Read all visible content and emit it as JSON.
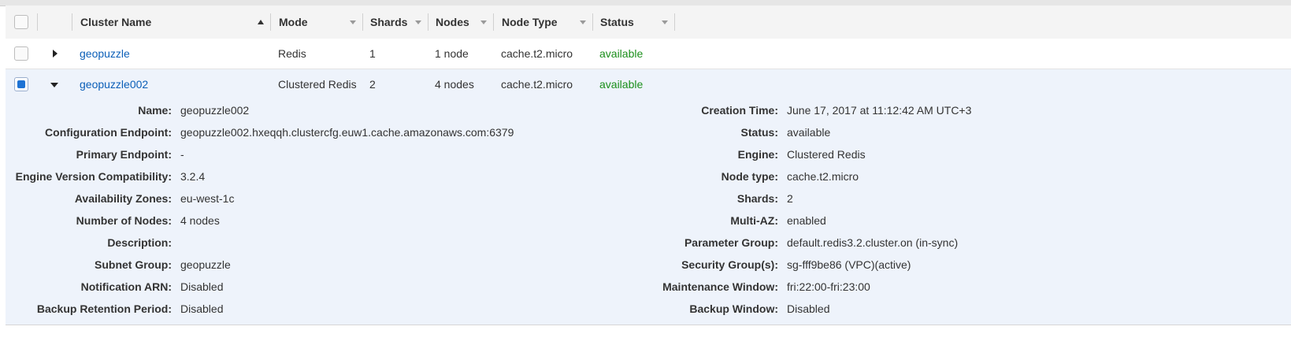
{
  "header": {
    "columns": [
      {
        "label": "Cluster Name"
      },
      {
        "label": "Mode"
      },
      {
        "label": "Shards"
      },
      {
        "label": "Nodes"
      },
      {
        "label": "Node Type"
      },
      {
        "label": "Status"
      }
    ]
  },
  "rows": [
    {
      "name": "geopuzzle",
      "mode": "Redis",
      "shards": "1",
      "nodes": "1 node",
      "node_type": "cache.t2.micro",
      "status": "available",
      "expanded": false,
      "selected": false
    },
    {
      "name": "geopuzzle002",
      "mode": "Clustered Redis",
      "shards": "2",
      "nodes": "4 nodes",
      "node_type": "cache.t2.micro",
      "status": "available",
      "expanded": true,
      "selected": true
    }
  ],
  "details": {
    "left": [
      {
        "label": "Name:",
        "value": "geopuzzle002"
      },
      {
        "label": "Configuration Endpoint:",
        "value": "geopuzzle002.hxeqqh.clustercfg.euw1.cache.amazonaws.com:6379"
      },
      {
        "label": "Primary Endpoint:",
        "value": "-"
      },
      {
        "label": "Engine Version Compatibility:",
        "value": "3.2.4"
      },
      {
        "label": "Availability Zones:",
        "value": "eu-west-1c"
      },
      {
        "label": "Number of Nodes:",
        "value": "4 nodes"
      },
      {
        "label": "Description:",
        "value": ""
      },
      {
        "label": "Subnet Group:",
        "value": "geopuzzle"
      },
      {
        "label": "Notification ARN:",
        "value": "Disabled"
      },
      {
        "label": "Backup Retention Period:",
        "value": "Disabled"
      }
    ],
    "right": [
      {
        "label": "Creation Time:",
        "value": "June 17, 2017 at 11:12:42 AM UTC+3"
      },
      {
        "label": "Status:",
        "value": "available"
      },
      {
        "label": "Engine:",
        "value": "Clustered Redis"
      },
      {
        "label": "Node type:",
        "value": "cache.t2.micro"
      },
      {
        "label": "Shards:",
        "value": "2"
      },
      {
        "label": "Multi-AZ:",
        "value": "enabled"
      },
      {
        "label": "Parameter Group:",
        "value": "default.redis3.2.cluster.on (in-sync)"
      },
      {
        "label": "Security Group(s):",
        "value": "sg-fff9be86 (VPC)(active)"
      },
      {
        "label": "Maintenance Window:",
        "value": "fri:22:00-fri:23:00"
      },
      {
        "label": "Backup Window:",
        "value": "Disabled"
      }
    ]
  },
  "colors": {
    "link": "#0b5fb8",
    "status_available": "#1b8f1b",
    "selected_row": "#eef3fb",
    "checkbox_checked": "#1e73d4"
  },
  "icons": {
    "sort": "sort-ascending-icon",
    "collapsed": "expand-arrow-right-icon",
    "expanded": "collapse-arrow-down-icon"
  }
}
